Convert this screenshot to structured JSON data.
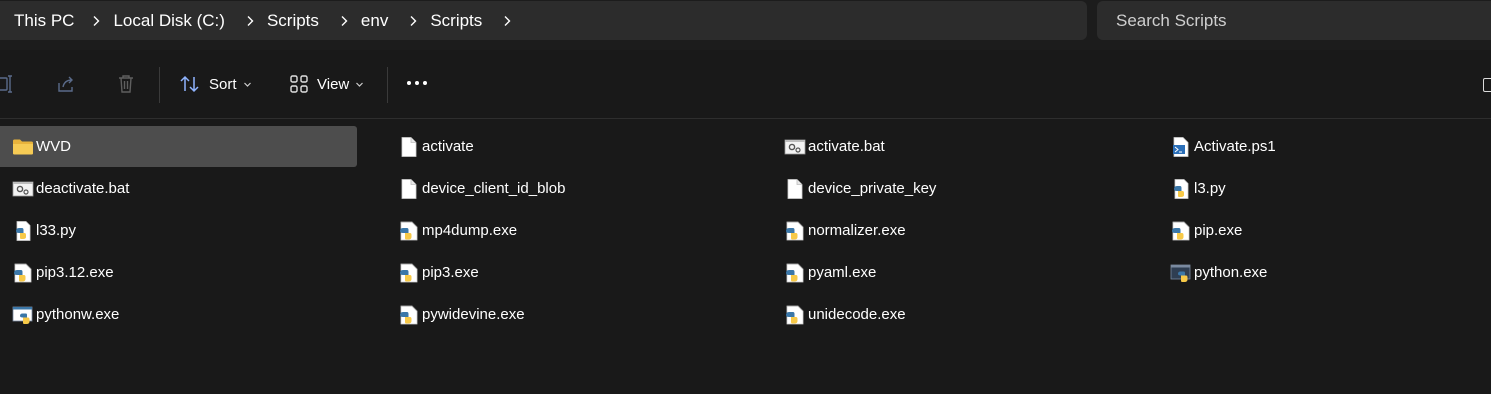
{
  "breadcrumb": [
    "This PC",
    "Local Disk (C:)",
    "Scripts",
    "env",
    "Scripts"
  ],
  "search": {
    "placeholder": "Search Scripts"
  },
  "toolbar": {
    "sort_label": "Sort",
    "view_label": "View"
  },
  "colors": {
    "background": "#191919",
    "address_bar": "#2c2c2c",
    "selected": "#4d4d4d",
    "folder": "#f2c44e"
  },
  "files": [
    {
      "name": "WVD",
      "icon": "folder-icon",
      "selected": true
    },
    {
      "name": "activate",
      "icon": "file-icon"
    },
    {
      "name": "activate.bat",
      "icon": "batch-icon"
    },
    {
      "name": "Activate.ps1",
      "icon": "powershell-icon"
    },
    {
      "name": "deactivate.bat",
      "icon": "batch-icon"
    },
    {
      "name": "device_client_id_blob",
      "icon": "file-icon"
    },
    {
      "name": "device_private_key",
      "icon": "file-icon"
    },
    {
      "name": "l3.py",
      "icon": "python-file-icon"
    },
    {
      "name": "l33.py",
      "icon": "python-file-icon"
    },
    {
      "name": "mp4dump.exe",
      "icon": "python-exe-icon"
    },
    {
      "name": "normalizer.exe",
      "icon": "python-exe-icon"
    },
    {
      "name": "pip.exe",
      "icon": "python-exe-icon"
    },
    {
      "name": "pip3.12.exe",
      "icon": "python-exe-icon"
    },
    {
      "name": "pip3.exe",
      "icon": "python-exe-icon"
    },
    {
      "name": "pyaml.exe",
      "icon": "python-exe-icon"
    },
    {
      "name": "python.exe",
      "icon": "python-console-icon"
    },
    {
      "name": "pythonw.exe",
      "icon": "python-window-icon"
    },
    {
      "name": "pywidevine.exe",
      "icon": "python-exe-icon"
    },
    {
      "name": "unidecode.exe",
      "icon": "python-exe-icon"
    }
  ]
}
